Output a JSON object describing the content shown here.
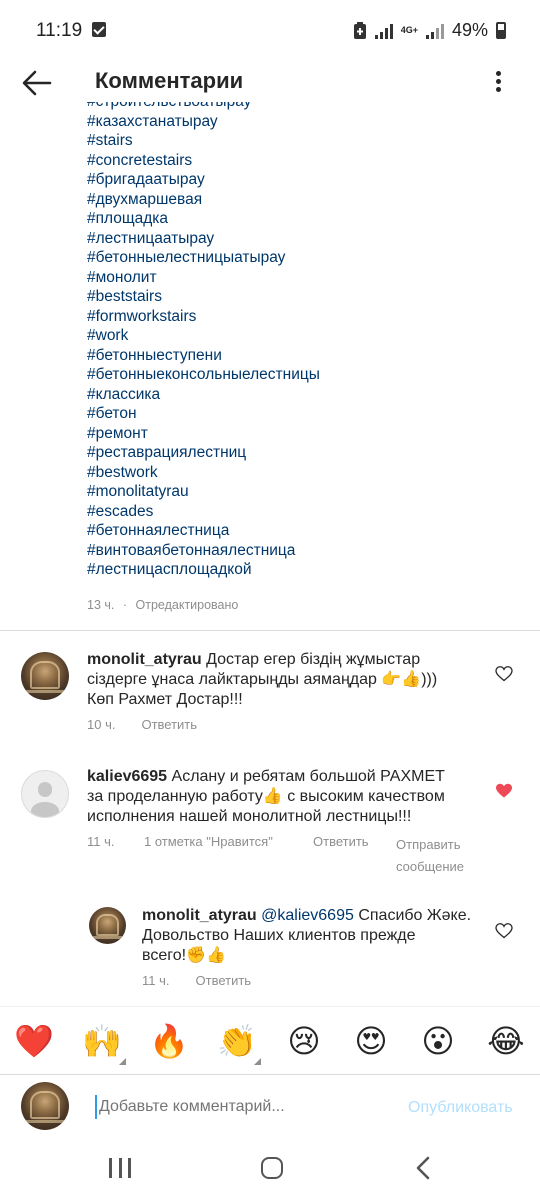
{
  "status_bar": {
    "time": "11:19",
    "network": "4G+",
    "battery": "49%"
  },
  "header": {
    "title": "Комментарии"
  },
  "caption": {
    "hashtags": [
      "#строительствоатырау",
      "#казахстанатырау",
      "#stairs",
      "#concretestairs",
      "#бригадаатырау",
      "#двухмаршевая",
      "#площадка",
      "#лестницаатырау",
      "#бетонныелестницыатырау",
      "#монолит",
      "#beststairs",
      "#formworkstairs",
      "#work",
      "#бетонныеступени",
      "#бетонныеконсольныелестницы",
      "#классика",
      "#бетон",
      "#ремонт",
      "#реставрациялестниц",
      "#bestwork",
      "#monolitatyrau",
      "#escades",
      "#бетоннаялестница",
      "#винтоваябетоннаялестница",
      "#лестницасплощадкой"
    ],
    "time": "13 ч.",
    "separator": "·",
    "edited": "Отредактировано"
  },
  "comments": [
    {
      "username": "monolit_atyrau",
      "text_line1": " Достар егер біздің жұмыстар",
      "text_line2": "сіздерге ұнаса лайктарыңды аямаңдар 👉👍)))",
      "text_line3": "Көп Рахмет Достар!!!",
      "time": "10 ч.",
      "reply": "Ответить",
      "liked": false
    },
    {
      "username": "kaliev6695",
      "text_line1": " Аслану  и ребятам большой РАХМЕТ",
      "text_line2": "за проделанную работу👍  с высоким качеством",
      "text_line3": "исполнения  нашей монолитной  лестницы!!!",
      "time": "11 ч.",
      "likes": "1 отметка \"Нравится\"",
      "reply": "Ответить",
      "send_line1": "Отправить",
      "send_line2": "сообщение",
      "liked": true
    },
    {
      "username": "monolit_atyrau",
      "mention": " @kaliev6695",
      "text_line1": " Спасибо Жәке.",
      "text_line2": "Довольство Наших клиентов прежде",
      "text_line3": "всего!✊👍",
      "time": "11 ч.",
      "reply": "Ответить",
      "liked": false
    }
  ],
  "emoji_bar": [
    "❤️",
    "🙌",
    "🔥",
    "👏",
    "😢",
    "😍",
    "😮",
    "😂"
  ],
  "composer": {
    "placeholder": "Добавьте комментарий...",
    "post_label": "Опубликовать"
  },
  "colors": {
    "hashtag": "#00376b",
    "meta": "#8e8e8e",
    "liked_heart": "#ed4956",
    "post_disabled": "#b2dffc"
  }
}
